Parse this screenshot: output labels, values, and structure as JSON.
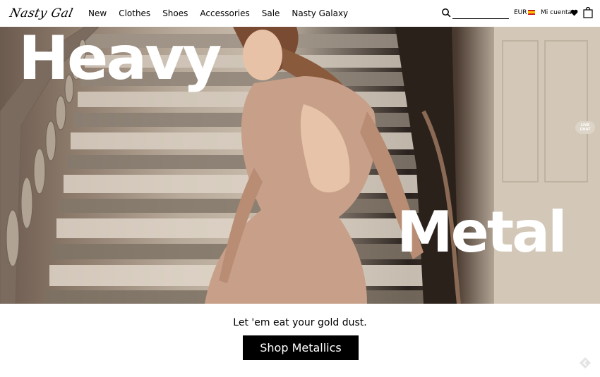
{
  "header": {
    "logo": "Nasty Gal",
    "nav": [
      "New",
      "Clothes",
      "Shoes",
      "Accessories",
      "Sale",
      "Nasty Galaxy"
    ],
    "search": {
      "value": "",
      "placeholder": ""
    },
    "currency": "EUR",
    "flag_icon": "spain-flag-icon",
    "account_label": "Mi cuenta",
    "icons": [
      "search-icon",
      "heart-icon",
      "shopping-bag-icon"
    ]
  },
  "hero": {
    "headline_top": "Heavy",
    "headline_bottom": "Metal",
    "live_chat_label": "LIVE CHAT"
  },
  "promo": {
    "tagline": "Let 'em eat your gold dust.",
    "cta_label": "Shop Metallics"
  },
  "colors": {
    "cta_background": "#000000",
    "headline_text": "#ffffff",
    "flag_red": "#c60b1e",
    "flag_yellow": "#ffc400"
  }
}
